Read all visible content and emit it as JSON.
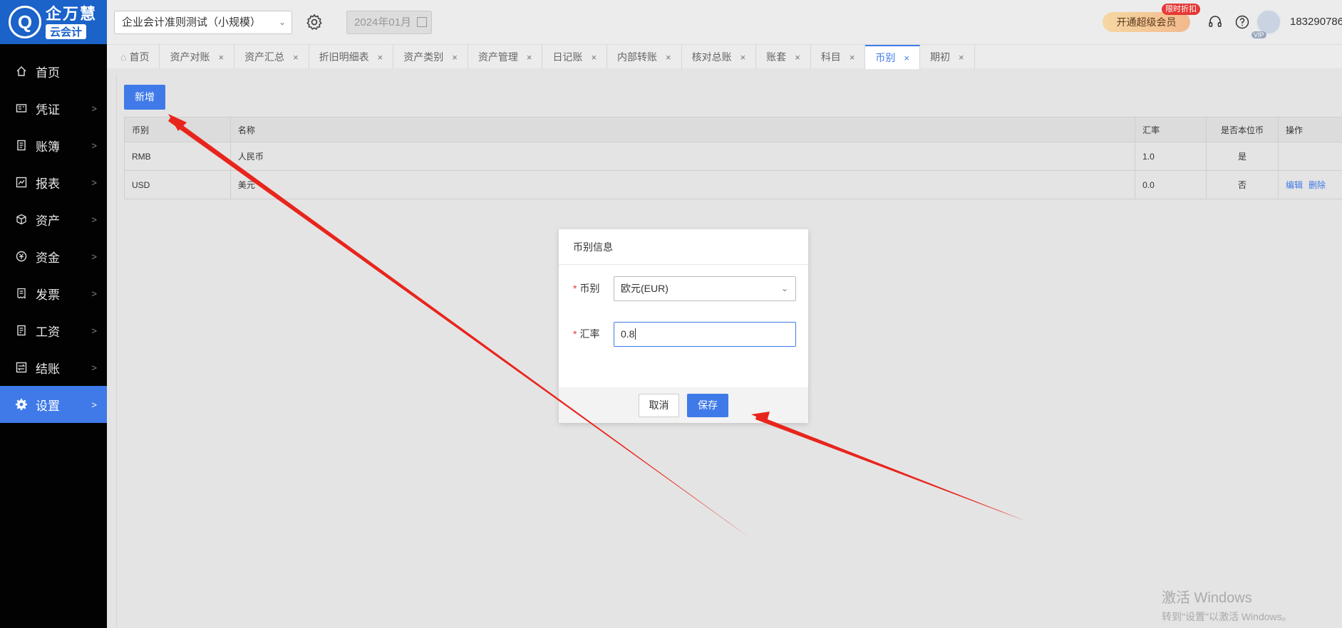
{
  "logo": {
    "mark": "Q",
    "name": "企万慧",
    "sub": "云会计"
  },
  "sidebar": {
    "items": [
      {
        "label": "首页",
        "icon": "home-icon"
      },
      {
        "label": "凭证",
        "icon": "voucher-icon"
      },
      {
        "label": "账簿",
        "icon": "ledger-icon"
      },
      {
        "label": "报表",
        "icon": "report-icon"
      },
      {
        "label": "资产",
        "icon": "asset-icon"
      },
      {
        "label": "资金",
        "icon": "money-icon"
      },
      {
        "label": "发票",
        "icon": "invoice-icon"
      },
      {
        "label": "工资",
        "icon": "salary-icon"
      },
      {
        "label": "结账",
        "icon": "closing-icon"
      },
      {
        "label": "设置",
        "icon": "settings-icon",
        "active": true
      }
    ]
  },
  "header": {
    "company": "企业会计准则测试（小规模）",
    "period": "2024年01月",
    "vip_label": "开通超级会员",
    "vip_badge": "限时折扣",
    "avatar_badge": "VIP",
    "phone": "183290786"
  },
  "tabs": [
    {
      "label": "首页"
    },
    {
      "label": "资产对账"
    },
    {
      "label": "资产汇总"
    },
    {
      "label": "折旧明细表"
    },
    {
      "label": "资产类别"
    },
    {
      "label": "资产管理"
    },
    {
      "label": "日记账"
    },
    {
      "label": "内部转账"
    },
    {
      "label": "核对总账"
    },
    {
      "label": "账套"
    },
    {
      "label": "科目"
    },
    {
      "label": "币别",
      "active": true
    },
    {
      "label": "期初"
    }
  ],
  "toolbar": {
    "add_label": "新增"
  },
  "table": {
    "columns": [
      "币别",
      "名称",
      "汇率",
      "是否本位币",
      "操作"
    ],
    "rows": [
      {
        "code": "RMB",
        "name": "人民币",
        "rate": "1.0",
        "is_base": "是",
        "actions": []
      },
      {
        "code": "USD",
        "name": "美元",
        "rate": "0.0",
        "is_base": "否",
        "actions": [
          "编辑",
          "删除"
        ]
      }
    ]
  },
  "modal": {
    "title": "币别信息",
    "currency_label": "币别",
    "currency_value": "欧元(EUR)",
    "rate_label": "汇率",
    "rate_value": "0.8",
    "cancel_label": "取消",
    "save_label": "保存"
  },
  "watermark": {
    "line1": "激活 Windows",
    "line2": "转到\"设置\"以激活 Windows。"
  },
  "colors": {
    "accent": "#3f7ae8",
    "sidebar_bg": "#020202",
    "arrow": "#e8251c"
  }
}
